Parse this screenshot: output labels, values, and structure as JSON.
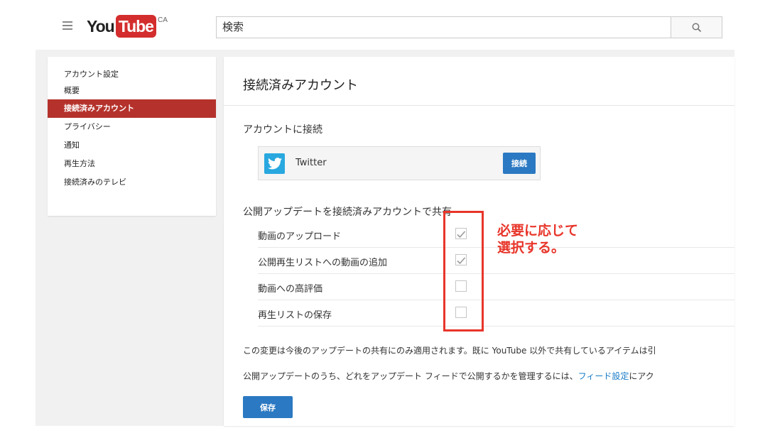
{
  "header": {
    "logo_you": "You",
    "logo_tube": "Tube",
    "logo_region": "CA",
    "search_value": "検索"
  },
  "sidebar": {
    "items": [
      {
        "label": "アカウント設定"
      },
      {
        "label": "概要"
      },
      {
        "label": "接続済みアカウント"
      },
      {
        "label": "プライバシー"
      },
      {
        "label": "通知"
      },
      {
        "label": "再生方法"
      },
      {
        "label": "接続済みのテレビ"
      }
    ]
  },
  "main": {
    "title": "接続済みアカウント",
    "connect_title": "アカウントに接続",
    "twitter": {
      "label": "Twitter",
      "button": "接続"
    },
    "share_title": "公開アップデートを接続済みアカウントで共有",
    "options": [
      {
        "label": "動画のアップロード",
        "checked": true
      },
      {
        "label": "公開再生リストへの動画の追加",
        "checked": true
      },
      {
        "label": "動画への高評価",
        "checked": false
      },
      {
        "label": "再生リストの保存",
        "checked": false
      }
    ],
    "note1": "この変更は今後のアップデートの共有にのみ適用されます。既に YouTube 以外で共有しているアイテムは引",
    "note2_pre": "公開アップデートのうち、どれをアップデート フィードで公開するかを管理するには、",
    "note2_link": "フィード設定",
    "note2_post": "にアク",
    "save_button": "保存"
  },
  "annotation": {
    "line1": "必要に応じて",
    "line2": "選択する。",
    "color": "#e8352a"
  }
}
